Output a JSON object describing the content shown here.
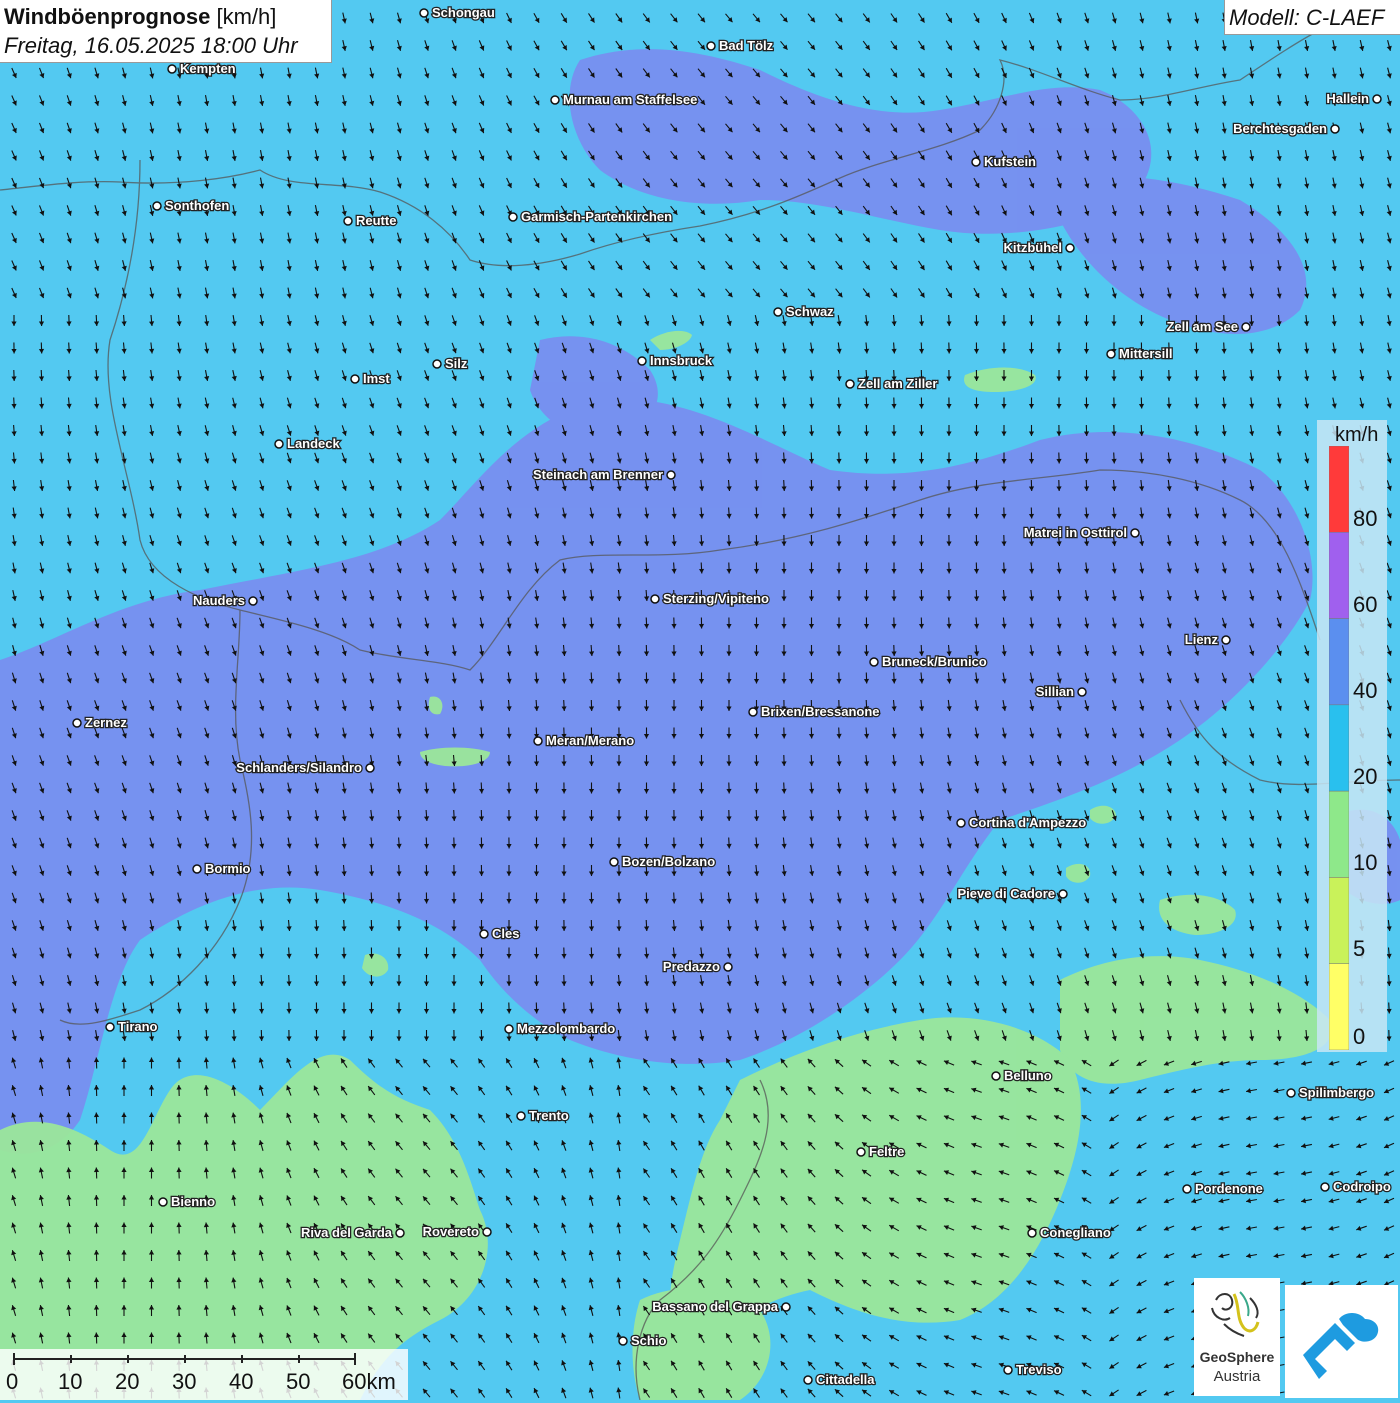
{
  "title": {
    "main": "Windböenprognose",
    "unit": "[km/h]",
    "datetime": "Freitag, 16.05.2025 18:00 Uhr"
  },
  "model": "Modell: C-LAEF",
  "legend": {
    "unit": "km/h",
    "ticks": [
      "80",
      "60",
      "40",
      "20",
      "10",
      "5",
      "0"
    ],
    "colors": [
      "#ff3a3a",
      "#a060ee",
      "#5b8fef",
      "#29c0ee",
      "#8ee88a",
      "#c9f25a",
      "#ffff66"
    ]
  },
  "logo": {
    "name": "GeoSphere",
    "sub": "Austria"
  },
  "scale": {
    "labels": [
      "0",
      "10",
      "20",
      "30",
      "40",
      "50",
      "60km"
    ]
  },
  "map": {
    "base_color": "#53c9f1",
    "strong_color": "#7a8cf0",
    "calm_color": "#9be79a",
    "arrow_color": "#111111",
    "cities": [
      {
        "name": "Schongau",
        "side": "right"
      },
      {
        "name": "Bad Tölz",
        "side": "right"
      },
      {
        "name": "Kempten",
        "side": "right"
      },
      {
        "name": "Murnau am Staffelsee",
        "side": "right"
      },
      {
        "name": "Hallein",
        "side": "left"
      },
      {
        "name": "Berchtesgaden",
        "side": "left"
      },
      {
        "name": "Kufstein",
        "side": "right"
      },
      {
        "name": "Sonthofen",
        "side": "right"
      },
      {
        "name": "Reutte",
        "side": "right"
      },
      {
        "name": "Garmisch-Partenkirchen",
        "side": "right"
      },
      {
        "name": "Kitzbühel",
        "side": "left"
      },
      {
        "name": "Schwaz",
        "side": "right"
      },
      {
        "name": "Zell am See",
        "side": "left"
      },
      {
        "name": "Innsbruck",
        "side": "right"
      },
      {
        "name": "Silz",
        "side": "right"
      },
      {
        "name": "Imst",
        "side": "right"
      },
      {
        "name": "Mittersill",
        "side": "right"
      },
      {
        "name": "Zell am Ziller",
        "side": "right"
      },
      {
        "name": "Landeck",
        "side": "right"
      },
      {
        "name": "Steinach am Brenner",
        "side": "left"
      },
      {
        "name": "Matrei in Osttirol",
        "side": "left"
      },
      {
        "name": "Nauders",
        "side": "left"
      },
      {
        "name": "Sterzing/Vipiteno",
        "side": "right"
      },
      {
        "name": "Lienz",
        "side": "left"
      },
      {
        "name": "Bruneck/Brunico",
        "side": "right"
      },
      {
        "name": "Sillian",
        "side": "left"
      },
      {
        "name": "Brixen/Bressanone",
        "side": "right"
      },
      {
        "name": "Zernez",
        "side": "right"
      },
      {
        "name": "Meran/Merano",
        "side": "right"
      },
      {
        "name": "Schlanders/Silandro",
        "side": "left"
      },
      {
        "name": "Cortina d'Ampezzo",
        "side": "right"
      },
      {
        "name": "Bozen/Bolzano",
        "side": "right"
      },
      {
        "name": "Bormio",
        "side": "right"
      },
      {
        "name": "Pieve di Cadore",
        "side": "left"
      },
      {
        "name": "Cles",
        "side": "right"
      },
      {
        "name": "Predazzo",
        "side": "left"
      },
      {
        "name": "Tirano",
        "side": "right"
      },
      {
        "name": "Mezzolombardo",
        "side": "right"
      },
      {
        "name": "Belluno",
        "side": "right"
      },
      {
        "name": "Spilimbergo",
        "side": "right"
      },
      {
        "name": "Trento",
        "side": "right"
      },
      {
        "name": "Feltre",
        "side": "right"
      },
      {
        "name": "Pordenone",
        "side": "right"
      },
      {
        "name": "Codroipo",
        "side": "right"
      },
      {
        "name": "Bienno",
        "side": "right"
      },
      {
        "name": "Riva del Garda",
        "side": "left"
      },
      {
        "name": "Rovereto",
        "side": "left"
      },
      {
        "name": "Conegliano",
        "side": "right"
      },
      {
        "name": "Bassano del Grappa",
        "side": "left"
      },
      {
        "name": "Schio",
        "side": "right"
      },
      {
        "name": "Treviso",
        "side": "right"
      },
      {
        "name": "Cittadella",
        "side": "right"
      }
    ]
  }
}
